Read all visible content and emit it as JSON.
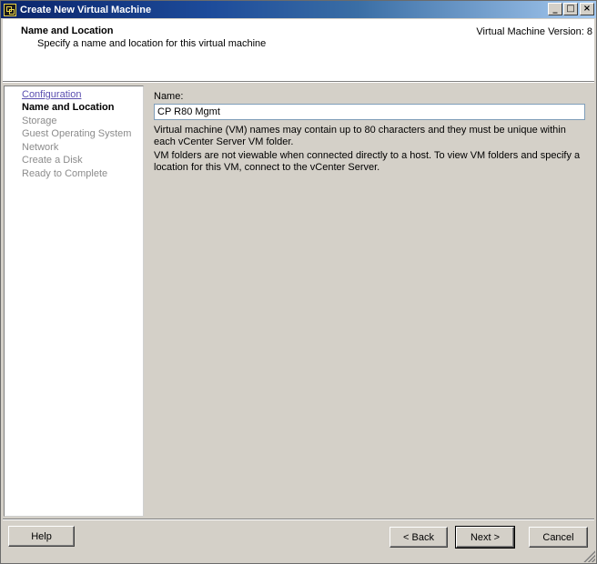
{
  "window": {
    "title": "Create New Virtual Machine",
    "controls": {
      "minimize": "_",
      "maximize": "□",
      "close": "×"
    }
  },
  "header": {
    "title": "Name and Location",
    "subtitle": "Specify a name and location for this virtual machine",
    "version": "Virtual Machine Version: 8"
  },
  "nav": {
    "items": [
      {
        "label": "Configuration",
        "state": "link"
      },
      {
        "label": "Name and Location",
        "state": "current"
      },
      {
        "label": "Storage",
        "state": "disabled"
      },
      {
        "label": "Guest Operating System",
        "state": "disabled"
      },
      {
        "label": "Network",
        "state": "disabled"
      },
      {
        "label": "Create a Disk",
        "state": "disabled"
      },
      {
        "label": "Ready to Complete",
        "state": "disabled"
      }
    ]
  },
  "content": {
    "name_label": "Name:",
    "name_value": "CP R80 Mgmt",
    "help_text_1": "Virtual machine (VM) names may contain up to 80 characters and they must be unique within each vCenter Server VM folder.",
    "help_text_2": "VM folders are not viewable when connected directly to a host. To view VM folders and specify a location for this VM, connect to the vCenter Server."
  },
  "footer": {
    "help_label": "Help",
    "back_label": "< Back",
    "next_label": "Next >",
    "cancel_label": "Cancel"
  }
}
